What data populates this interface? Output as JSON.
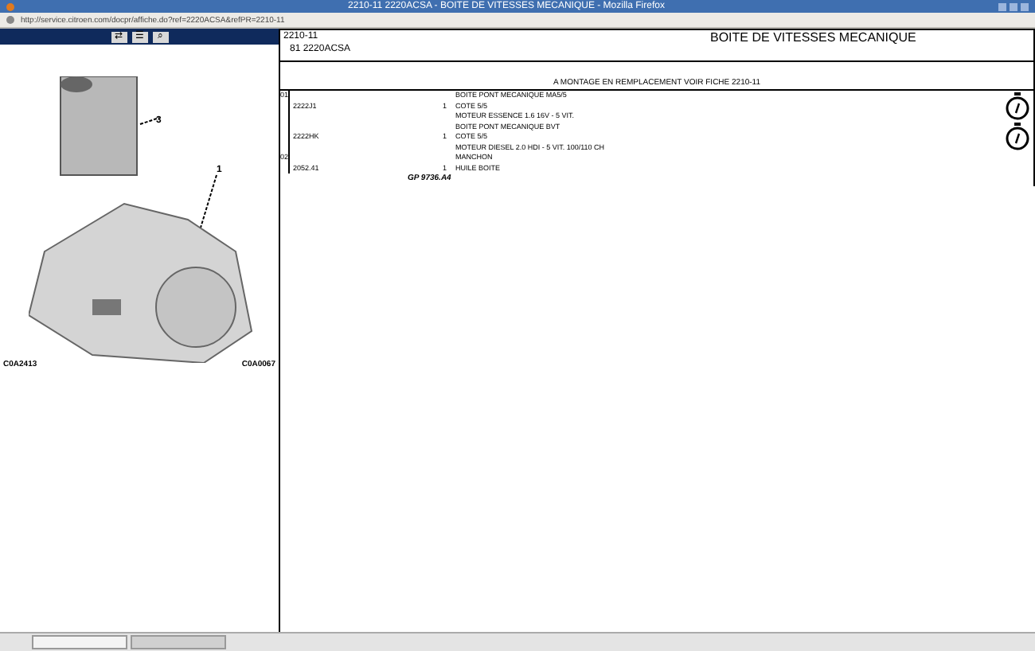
{
  "window": {
    "title": "2210-11 2220ACSA - BOITE DE VITESSES MECANIQUE - Mozilla Firefox"
  },
  "address_bar": {
    "value": "http://service.citroen.com/docpr/affiche.do?ref=2220ACSA&refPR=2210-11"
  },
  "left_panel": {
    "tool_buttons": [
      "⇄",
      "☰",
      "⌕"
    ],
    "callouts": [
      "3",
      "1"
    ],
    "codes": [
      "C0A2413",
      "C0A0067"
    ]
  },
  "header": {
    "code": "2210-11",
    "title": "BOITE DE VITESSES MECANIQUE",
    "reference": "81 2220ACSA"
  },
  "table": {
    "caption": "A MONTAGE EN REMPLACEMENT VOIR FICHE 2210-11",
    "rows": [
      {
        "item": "01",
        "part": "",
        "qty": "",
        "text": "BOITE PONT MECANIQUE MA5/5",
        "timer": false
      },
      {
        "item": "",
        "part": "2222J1",
        "qty": "1",
        "text": "COTE 5/5",
        "timer": true
      },
      {
        "item": "",
        "part": "",
        "qty": "",
        "text": "MOTEUR ESSENCE 1.6 16V - 5 VIT.",
        "timer": false
      },
      {
        "item": "",
        "part": "",
        "qty": "",
        "text": "BOITE PONT MECANIQUE BVT",
        "timer": false
      },
      {
        "item": "",
        "part": "2222HK",
        "qty": "1",
        "text": "COTE 5/5",
        "timer": true
      },
      {
        "item": "",
        "part": "",
        "qty": "",
        "text": "MOTEUR DIESEL 2.0 HDI - 5 VIT. 100/110 CH",
        "timer": false
      },
      {
        "item": "02",
        "part": "",
        "qty": "",
        "text": "MANCHON",
        "timer": false
      },
      {
        "item": "",
        "part": "2052.41",
        "qty": "1",
        "text": "HUILE BOITE",
        "timer": false
      }
    ],
    "price": "GP 9736.A4"
  }
}
